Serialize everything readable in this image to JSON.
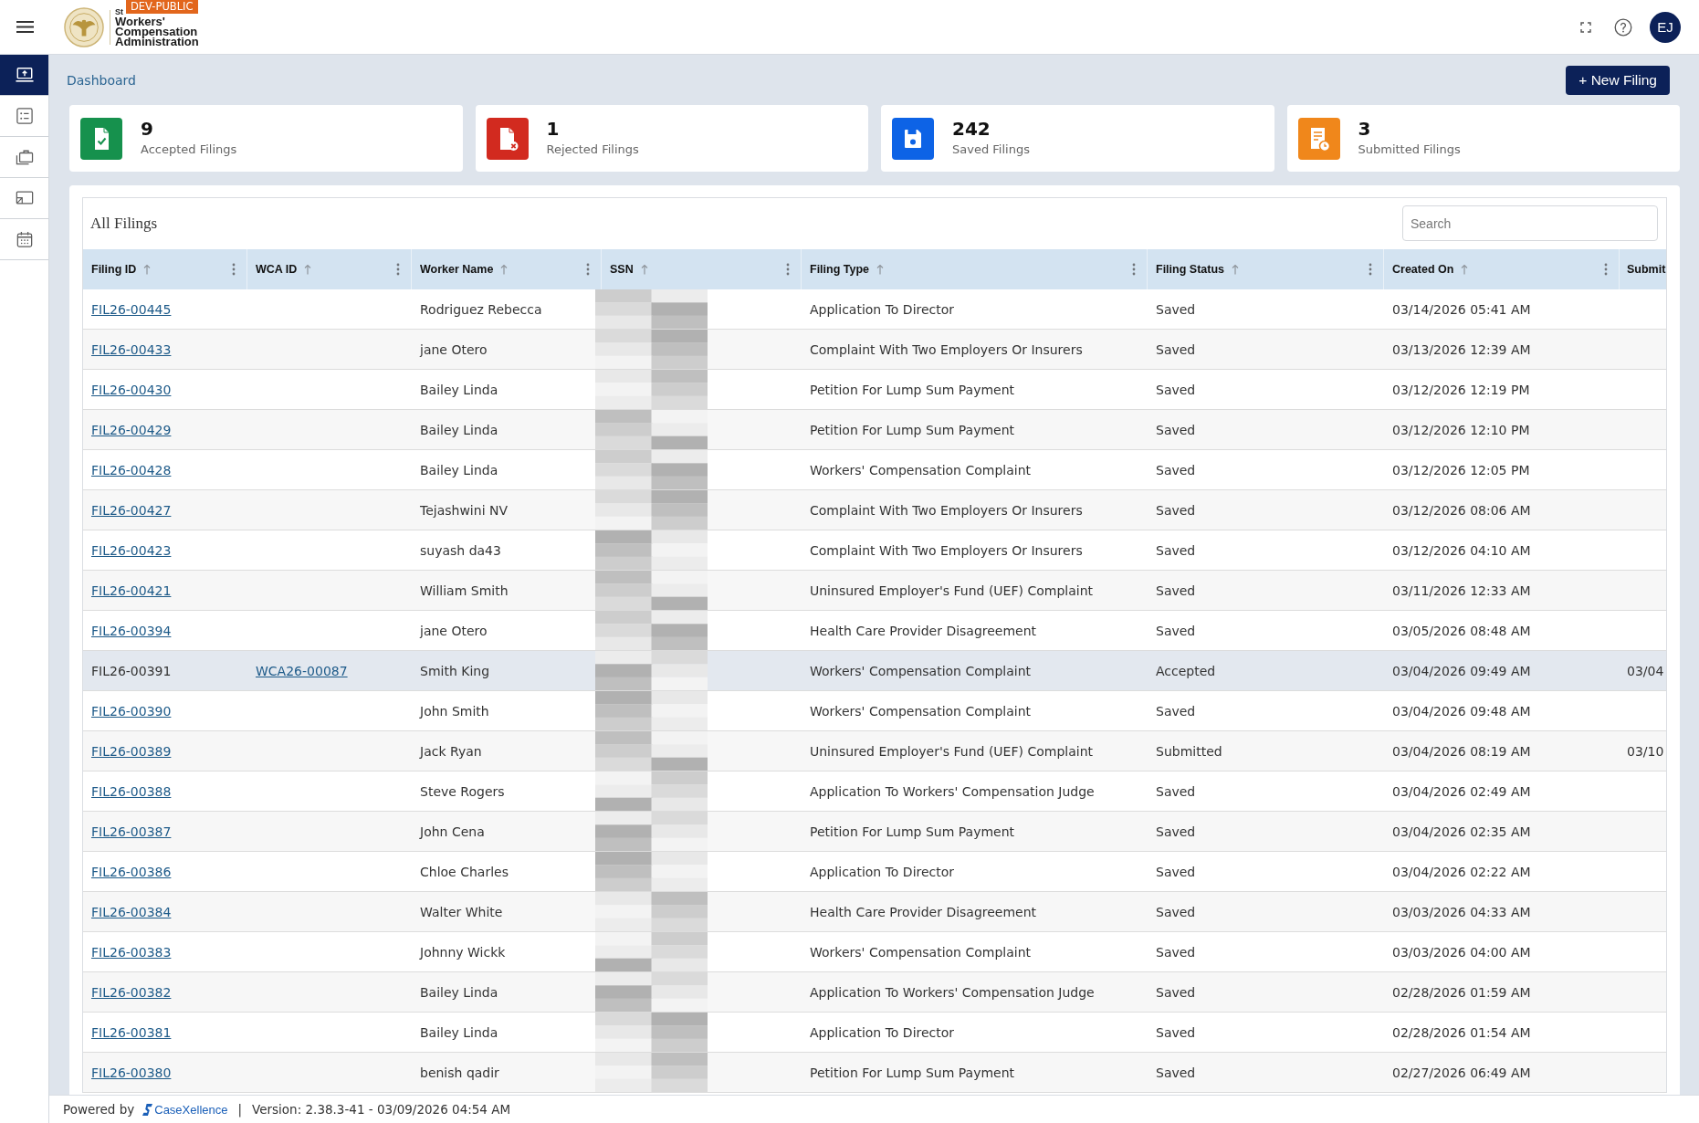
{
  "header": {
    "logo_prefix": "St",
    "organization": "Workers' Compensation Administration",
    "environment_badge": "DEV-PUBLIC",
    "avatar_initials": "EJ"
  },
  "sidebar": {
    "items": [
      {
        "selected": true
      },
      {
        "selected": false
      },
      {
        "selected": false
      },
      {
        "selected": false
      },
      {
        "selected": false
      }
    ]
  },
  "breadcrumb": "Dashboard",
  "new_filing_button": "+ New Filing",
  "stats": [
    {
      "kind": "accepted",
      "value": "9",
      "label": "Accepted Filings",
      "color": "#16914d"
    },
    {
      "kind": "rejected",
      "value": "1",
      "label": "Rejected Filings",
      "color": "#d22a1f"
    },
    {
      "kind": "saved",
      "value": "242",
      "label": "Saved Filings",
      "color": "#0d63e6"
    },
    {
      "kind": "submitted",
      "value": "3",
      "label": "Submitted Filings",
      "color": "#f0871b"
    }
  ],
  "table": {
    "title": "All Filings",
    "search": {
      "placeholder": "Search"
    },
    "columns": [
      {
        "label": "Filing ID",
        "sortable": true
      },
      {
        "label": "WCA ID",
        "sortable": true
      },
      {
        "label": "Worker Name",
        "sortable": true
      },
      {
        "label": "SSN",
        "sortable": true
      },
      {
        "label": "Filing Type",
        "sortable": true
      },
      {
        "label": "Filing Status",
        "sortable": true
      },
      {
        "label": "Created On",
        "sortable": true
      },
      {
        "label": "Submit",
        "sortable": false
      }
    ],
    "rows": [
      {
        "filing_id": {
          "text": "FIL26-00445",
          "link": true
        },
        "worker_name": "Rodriguez Rebecca",
        "filing_type": "Application To Director",
        "filing_status": "Saved",
        "created_on": "03/14/2026 05:41 AM",
        "selected": false
      },
      {
        "filing_id": {
          "text": "FIL26-00433",
          "link": true
        },
        "worker_name": "jane Otero",
        "filing_type": "Complaint With Two Employers Or Insurers",
        "filing_status": "Saved",
        "created_on": "03/13/2026 12:39 AM",
        "selected": false
      },
      {
        "filing_id": {
          "text": "FIL26-00430",
          "link": true
        },
        "worker_name": "Bailey Linda",
        "filing_type": "Petition For Lump Sum Payment",
        "filing_status": "Saved",
        "created_on": "03/12/2026 12:19 PM",
        "selected": false
      },
      {
        "filing_id": {
          "text": "FIL26-00429",
          "link": true
        },
        "worker_name": "Bailey Linda",
        "filing_type": "Petition For Lump Sum Payment",
        "filing_status": "Saved",
        "created_on": "03/12/2026 12:10 PM",
        "selected": false
      },
      {
        "filing_id": {
          "text": "FIL26-00428",
          "link": true
        },
        "worker_name": "Bailey Linda",
        "filing_type": "Workers' Compensation Complaint",
        "filing_status": "Saved",
        "created_on": "03/12/2026 12:05 PM",
        "selected": false
      },
      {
        "filing_id": {
          "text": "FIL26-00427",
          "link": true
        },
        "worker_name": "Tejashwini NV",
        "filing_type": "Complaint With Two Employers Or Insurers",
        "filing_status": "Saved",
        "created_on": "03/12/2026 08:06 AM",
        "selected": false
      },
      {
        "filing_id": {
          "text": "FIL26-00423",
          "link": true
        },
        "worker_name": "suyash da43",
        "filing_type": "Complaint With Two Employers Or Insurers",
        "filing_status": "Saved",
        "created_on": "03/12/2026 04:10 AM",
        "selected": false
      },
      {
        "filing_id": {
          "text": "FIL26-00421",
          "link": true
        },
        "worker_name": "William Smith",
        "filing_type": "Uninsured Employer's Fund (UEF) Complaint",
        "filing_status": "Saved",
        "created_on": "03/11/2026 12:33 AM",
        "selected": false
      },
      {
        "filing_id": {
          "text": "FIL26-00394",
          "link": true
        },
        "worker_name": "jane Otero",
        "filing_type": "Health Care Provider Disagreement",
        "filing_status": "Saved",
        "created_on": "03/05/2026 08:48 AM",
        "selected": false
      },
      {
        "filing_id": {
          "text": "FIL26-00391",
          "link": false
        },
        "wca_id": {
          "text": "WCA26-00087",
          "link": true
        },
        "worker_name": "Smith King",
        "filing_type": "Workers' Compensation Complaint",
        "filing_status": "Accepted",
        "created_on": "03/04/2026 09:49 AM",
        "column_8": "03/04",
        "selected": true
      },
      {
        "filing_id": {
          "text": "FIL26-00390",
          "link": true
        },
        "worker_name": "John Smith",
        "filing_type": "Workers' Compensation Complaint",
        "filing_status": "Saved",
        "created_on": "03/04/2026 09:48 AM",
        "selected": false
      },
      {
        "filing_id": {
          "text": "FIL26-00389",
          "link": true
        },
        "worker_name": "Jack Ryan",
        "filing_type": "Uninsured Employer's Fund (UEF) Complaint",
        "filing_status": "Submitted",
        "created_on": "03/04/2026 08:19 AM",
        "column_8": "03/10",
        "selected": false
      },
      {
        "filing_id": {
          "text": "FIL26-00388",
          "link": true
        },
        "worker_name": "Steve Rogers",
        "filing_type": "Application To Workers' Compensation Judge",
        "filing_status": "Saved",
        "created_on": "03/04/2026 02:49 AM",
        "selected": false
      },
      {
        "filing_id": {
          "text": "FIL26-00387",
          "link": true
        },
        "worker_name": "John Cena",
        "filing_type": "Petition For Lump Sum Payment",
        "filing_status": "Saved",
        "created_on": "03/04/2026 02:35 AM",
        "selected": false
      },
      {
        "filing_id": {
          "text": "FIL26-00386",
          "link": true
        },
        "worker_name": "Chloe Charles",
        "filing_type": "Application To Director",
        "filing_status": "Saved",
        "created_on": "03/04/2026 02:22 AM",
        "selected": false
      },
      {
        "filing_id": {
          "text": "FIL26-00384",
          "link": true
        },
        "worker_name": "Walter White",
        "filing_type": "Health Care Provider Disagreement",
        "filing_status": "Saved",
        "created_on": "03/03/2026 04:33 AM",
        "selected": false
      },
      {
        "filing_id": {
          "text": "FIL26-00383",
          "link": true
        },
        "worker_name": "Johnny Wickk",
        "filing_type": "Workers' Compensation Complaint",
        "filing_status": "Saved",
        "created_on": "03/03/2026 04:00 AM",
        "selected": false
      },
      {
        "filing_id": {
          "text": "FIL26-00382",
          "link": true
        },
        "worker_name": "Bailey Linda",
        "filing_type": "Application To Workers' Compensation Judge",
        "filing_status": "Saved",
        "created_on": "02/28/2026 01:59 AM",
        "selected": false
      },
      {
        "filing_id": {
          "text": "FIL26-00381",
          "link": true
        },
        "worker_name": "Bailey Linda",
        "filing_type": "Application To Director",
        "filing_status": "Saved",
        "created_on": "02/28/2026 01:54 AM",
        "selected": false
      },
      {
        "filing_id": {
          "text": "FIL26-00380",
          "link": true
        },
        "worker_name": "benish qadir",
        "filing_type": "Petition For Lump Sum Payment",
        "filing_status": "Saved",
        "created_on": "02/27/2026 06:49 AM",
        "selected": false
      }
    ]
  },
  "footer": {
    "powered_by": "Powered by",
    "brand": "CaseXellence",
    "separator": "|",
    "version": "Version: 2.38.3-41 - 03/09/2026 04:54 AM"
  }
}
